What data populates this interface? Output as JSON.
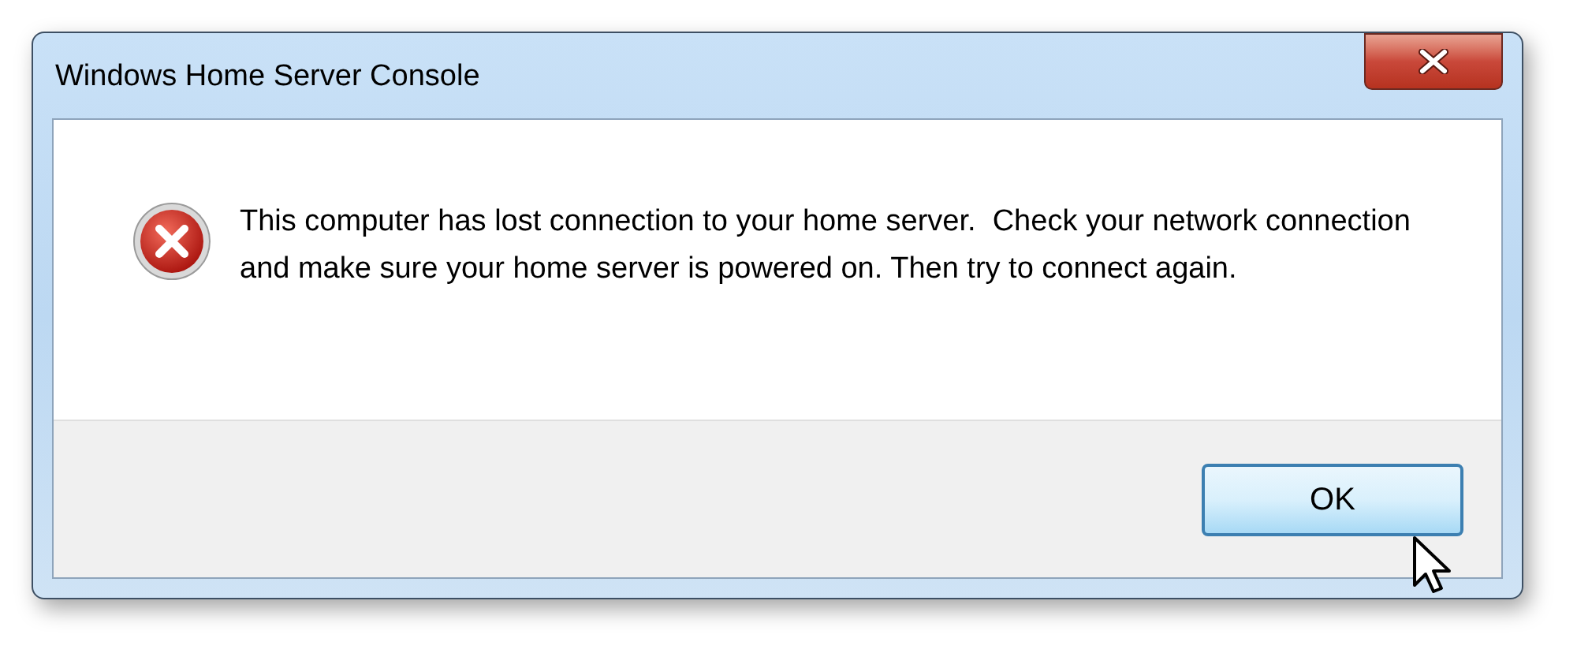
{
  "window": {
    "title": "Windows Home Server Console"
  },
  "message": "This computer has lost connection to your home server.  Check your network connection and make sure your home server is powered on. Then try to connect again.",
  "buttons": [
    "OK"
  ]
}
